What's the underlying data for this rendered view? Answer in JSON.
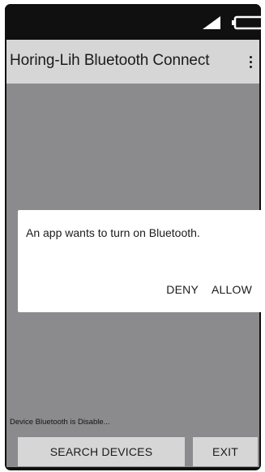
{
  "app_bar": {
    "title": "Horing-Lih Bluetooth Connect"
  },
  "dialog": {
    "message": "An app wants to turn on Bluetooth.",
    "deny_label": "DENY",
    "allow_label": "ALLOW"
  },
  "status": {
    "text": "Device Bluetooth is Disable..."
  },
  "buttons": {
    "search_label": "SEARCH DEVICES",
    "exit_label": "EXIT"
  },
  "icons": {
    "signal": "signal-icon",
    "battery": "battery-icon",
    "overflow": "more-vert-icon"
  },
  "colors": {
    "status_bar": "#101010",
    "app_bar": "#d6d6d6",
    "background": "#8b8b8d",
    "dialog": "#ffffff",
    "button": "#d6d6d6",
    "text": "#1b1b1b"
  }
}
